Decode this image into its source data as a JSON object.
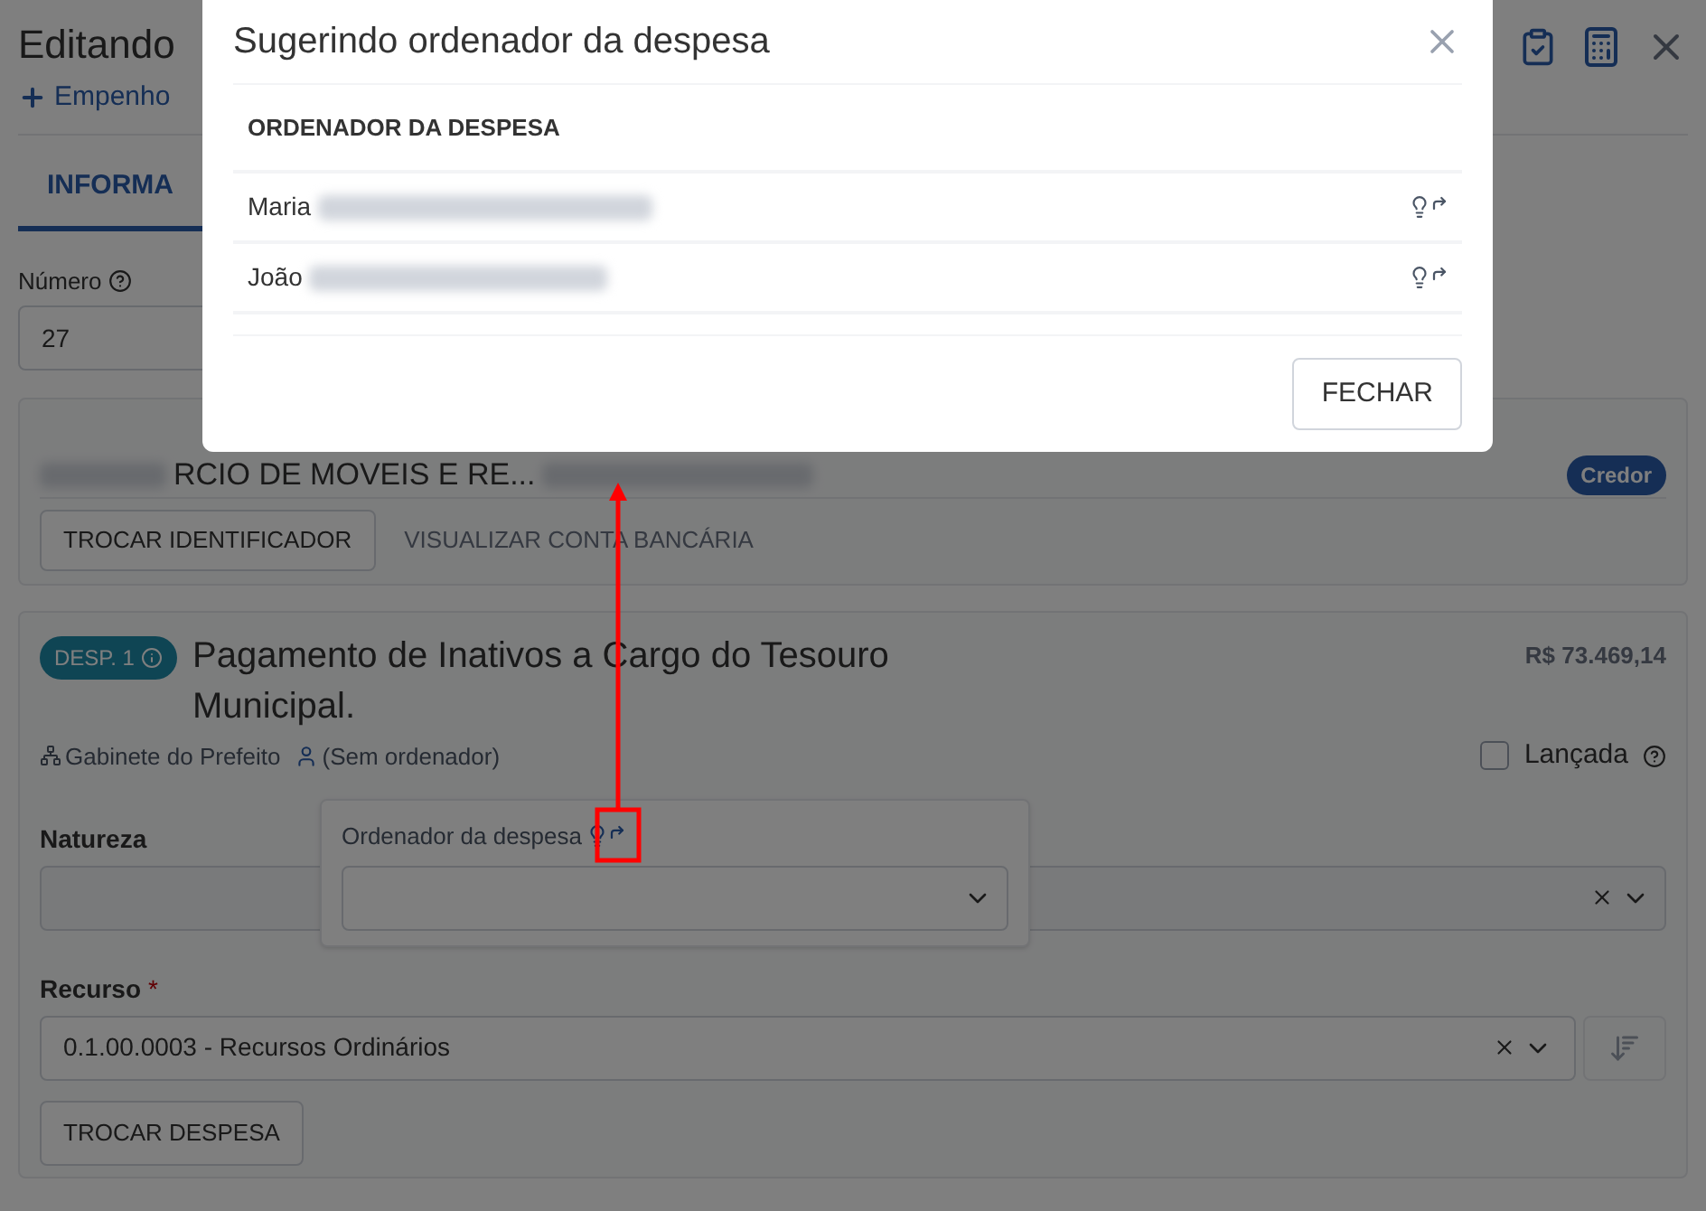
{
  "page": {
    "title": "Editando",
    "add_link": "Empenho",
    "tab": {
      "label": "INFORMA",
      "selected": true
    },
    "numero": {
      "label": "Número",
      "value": "27"
    },
    "creditor": {
      "name": "RCIO DE MOVEIS E RE...",
      "badge": "Credor",
      "buttons": [
        "TROCAR IDENTIFICADOR",
        "VISUALIZAR CONTA BANCÁRIA"
      ]
    },
    "expense": {
      "badge": "DESP. 1",
      "title": "Pagamento de Inativos a Cargo do Tesouro Municipal.",
      "amount": "R$ 73.469,14",
      "unit": "Gabinete do Prefeito",
      "ordenador": "(Sem ordenador)",
      "lancada": {
        "label": "Lançada",
        "checked": false
      },
      "natureza": {
        "label": "Natureza"
      },
      "recurso": {
        "label": "Recurso",
        "required_mark": "*",
        "value": "0.1.00.0003 - Recursos Ordinários"
      },
      "button": "TROCAR DESPESA"
    },
    "popover": {
      "label": "Ordenador da despesa"
    }
  },
  "modal": {
    "title": "Sugerindo ordenador da despesa",
    "column": "ORDENADOR DA DESPESA",
    "rows": [
      {
        "name": "Maria"
      },
      {
        "name": "João"
      }
    ],
    "button": "FECHAR"
  }
}
